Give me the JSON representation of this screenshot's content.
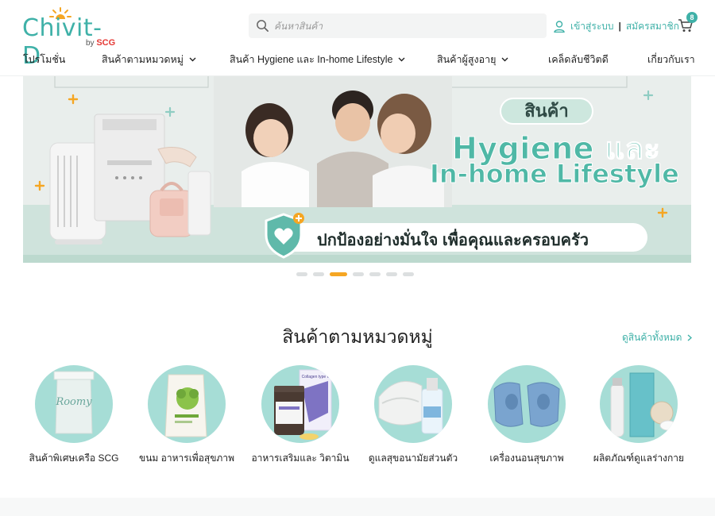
{
  "logo": {
    "brand": "Chivit-D",
    "by": "by",
    "company": "SCG"
  },
  "search": {
    "placeholder": "ค้นหาสินค้า"
  },
  "account": {
    "login": "เข้าสู่ระบบ",
    "separator": "|",
    "register": "สมัครสมาชิก"
  },
  "cart": {
    "count": "8"
  },
  "nav": {
    "items": [
      {
        "label": "โปรโมชั่น"
      },
      {
        "label": "สินค้าตามหมวดหมู่"
      },
      {
        "label": "สินค้า Hygiene และ In-home Lifestyle"
      },
      {
        "label": "สินค้าผู้สูงอายุ"
      },
      {
        "label": "เคล็ดลับชีวิตดี"
      },
      {
        "label": "เกี่ยวกับเรา"
      }
    ]
  },
  "banner": {
    "title_line1": "สินค้า",
    "title_line2": "Hygiene และ",
    "title_line3": "In-home Lifestyle",
    "slogan": "ปกป้องอย่างมั่นใจ เพื่อคุณและครอบครัว",
    "slides_total": 7,
    "active_slide": 3
  },
  "categories": {
    "title": "สินค้าตามหมวดหมู่",
    "see_all": "ดูสินค้าทั้งหมด",
    "items": [
      {
        "label": "สินค้าพิเศษเครือ SCG",
        "product_text": "Roomy"
      },
      {
        "label": "ขนม อาหารเพื่อสุขภาพ"
      },
      {
        "label": "อาหารเสริมและ วิตามิน",
        "product_text": "Collagen type II"
      },
      {
        "label": "ดูแลสุขอนามัยส่วนตัว"
      },
      {
        "label": "เครื่องนอนสุขภาพ"
      },
      {
        "label": "ผลิตภัณฑ์ดูแลร่างกาย"
      }
    ]
  },
  "colors": {
    "brand_teal": "#3fb1a8",
    "accent_orange": "#f5a623",
    "category_circle": "#a6ddd6"
  }
}
